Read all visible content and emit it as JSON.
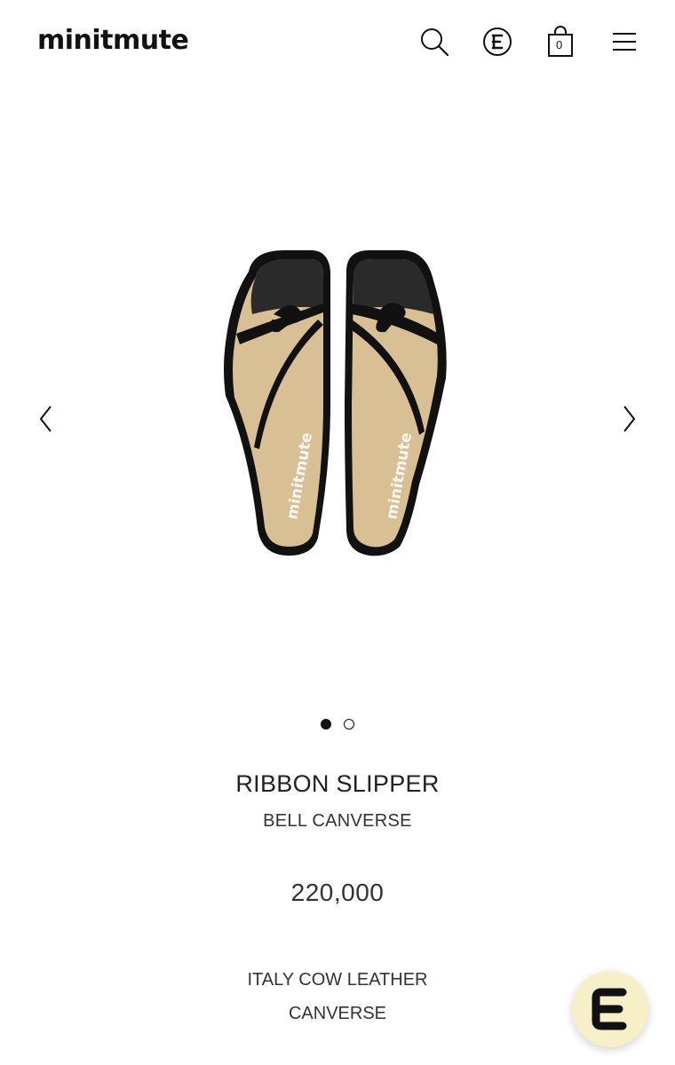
{
  "header": {
    "logo": "minitmute",
    "icons": [
      "search-icon",
      "currency-e-icon",
      "shopping-bag-icon",
      "hamburger-menu-icon"
    ],
    "cart_count": "0"
  },
  "gallery": {
    "prev_icon": "chevron-left-icon",
    "next_icon": "chevron-right-icon",
    "insole_text": "minitmute",
    "slide_count": 2,
    "active_slide": 1
  },
  "product": {
    "name": "RIBBON SLIPPER",
    "color": "BELL CANVERSE",
    "price": "220,000",
    "material_line1": "ITALY COW LEATHER",
    "material_line2": "CANVERSE"
  },
  "colors": {
    "text": "#222222",
    "shoe_beige": "#d9bf94",
    "shoe_black": "#111111",
    "fab_bg": "#f7efc8"
  }
}
